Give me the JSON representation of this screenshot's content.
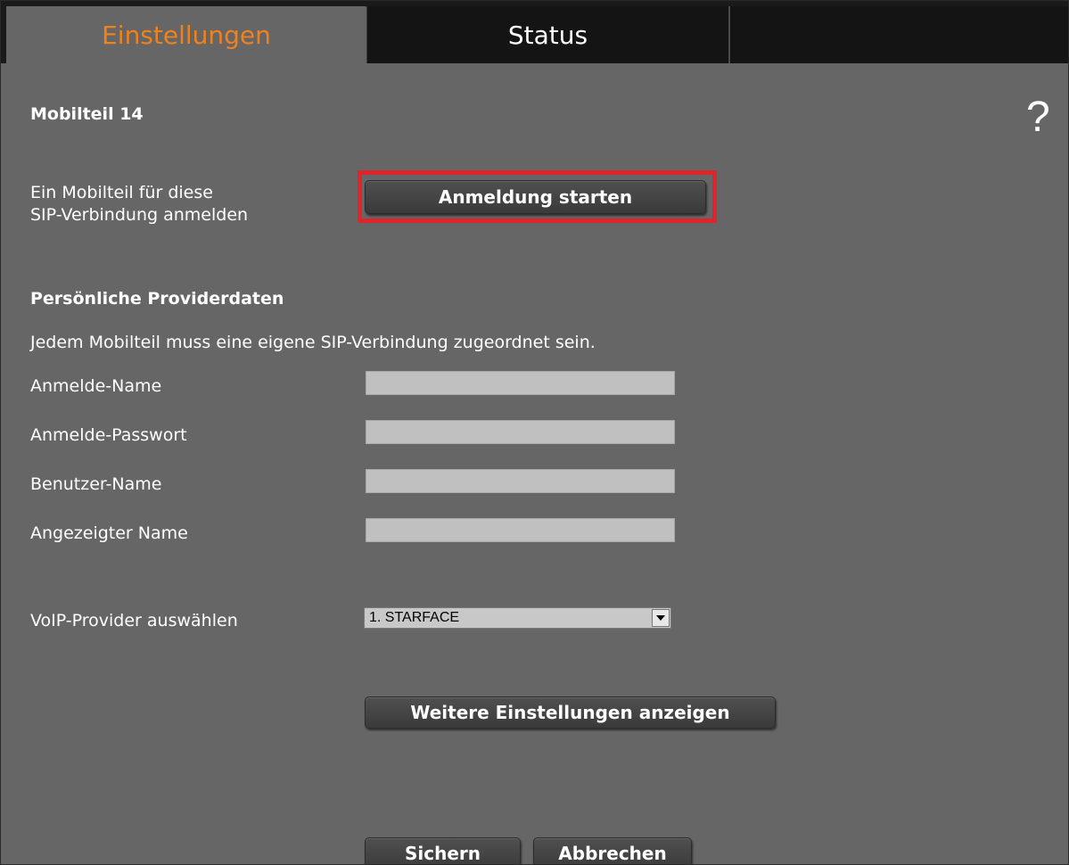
{
  "tabs": {
    "einstellungen": "Einstellungen",
    "status": "Status"
  },
  "section_title": "Mobilteil 14",
  "help_icon": "?",
  "register": {
    "description_line1": "Ein Mobilteil für diese",
    "description_line2": "SIP-Verbindung anmelden",
    "button_label": "Anmeldung starten"
  },
  "provider": {
    "heading": "Persönliche Providerdaten",
    "note": "Jedem Mobilteil muss eine eigene SIP-Verbindung zugeordnet sein.",
    "fields": {
      "login_name": {
        "label": "Anmelde-Name",
        "value": ""
      },
      "login_password": {
        "label": "Anmelde-Passwort",
        "value": ""
      },
      "user_name": {
        "label": "Benutzer-Name",
        "value": ""
      },
      "display_name": {
        "label": "Angezeigter Name",
        "value": ""
      }
    }
  },
  "voip": {
    "label": "VoIP-Provider auswählen",
    "selected": "1. STARFACE"
  },
  "buttons": {
    "more_settings": "Weitere Einstellungen anzeigen",
    "save": "Sichern",
    "cancel": "Abbrechen"
  },
  "colors": {
    "active_tab_text": "#f0821e",
    "highlight": "#e0242c",
    "panel_bg": "#666666"
  }
}
